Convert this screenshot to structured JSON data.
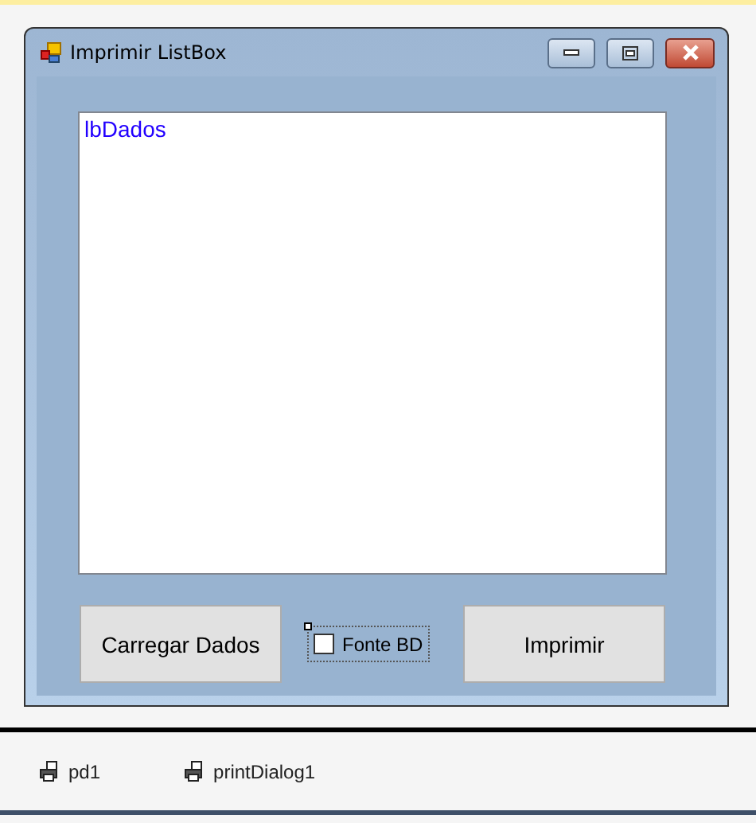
{
  "window": {
    "title": "Imprimir ListBox"
  },
  "listbox": {
    "items": [
      "lbDados"
    ]
  },
  "buttons": [
    {
      "kind": "button",
      "label": "Carregar Dados"
    },
    {
      "kind": "checkbox",
      "label": "Fonte BD",
      "checked": false
    },
    {
      "kind": "button",
      "label": "Imprimir"
    }
  ],
  "component_tray": [
    {
      "label": "pd1"
    },
    {
      "label": "printDialog1"
    }
  ]
}
